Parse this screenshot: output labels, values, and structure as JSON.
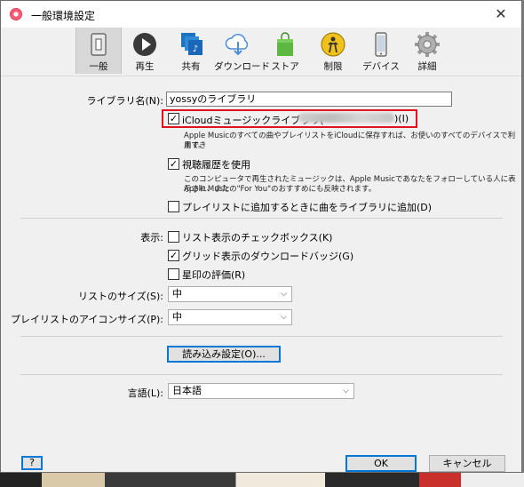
{
  "window": {
    "title": "一般環境設定",
    "close_glyph": "✕"
  },
  "toolbar": {
    "tabs": [
      {
        "label": "一般",
        "icon": "general-switch-icon"
      },
      {
        "label": "再生",
        "icon": "play-icon"
      },
      {
        "label": "共有",
        "icon": "sharing-icon"
      },
      {
        "label": "ダウンロード",
        "icon": "cloud-download-icon"
      },
      {
        "label": "ストア",
        "icon": "store-bag-icon"
      },
      {
        "label": "制限",
        "icon": "parental-restrictions-icon"
      },
      {
        "label": "デバイス",
        "icon": "device-phone-icon"
      },
      {
        "label": "詳細",
        "icon": "gear-icon"
      }
    ],
    "selected": "一般"
  },
  "library": {
    "name_label": "ライブラリ名(N):",
    "name_value": "yossyのライブラリ",
    "icloud_label_prefix": "iCloudミュージックライブラリ(",
    "icloud_label_suffix": ")(I)",
    "icloud_checked": true,
    "icloud_desc_line1": "Apple Musicのすべての曲やプレイリストをiCloudに保存すれば、お使いのすべてのデバイスで利用でき",
    "icloud_desc_line2": "ます。",
    "history_label": "視聴履歴を使用",
    "history_checked": true,
    "history_desc_line1": "このコンピュータで再生されたミュージックは、Apple Musicであなたをフォローしている人に表示され、また",
    "history_desc_line2": "Apple Musicの\"For You\"のおすすめにも反映されます。",
    "playlist_add_label": "プレイリストに追加するときに曲をライブラリに追加(D)",
    "playlist_add_checked": false
  },
  "display": {
    "label": "表示:",
    "list_checkbox_label": "リスト表示のチェックボックス(K)",
    "list_checkbox_checked": false,
    "grid_download_label": "グリッド表示のダウンロードバッジ(G)",
    "grid_download_checked": true,
    "star_rating_label": "星印の評価(R)",
    "star_rating_checked": false,
    "check_glyph": "✓"
  },
  "list_size": {
    "label": "リストのサイズ(S):",
    "value": "中"
  },
  "playlist_icon_size": {
    "label": "プレイリストのアイコンサイズ(P):",
    "value": "中"
  },
  "import_button": "読み込み設定(O)...",
  "language": {
    "label": "言語(L):",
    "value": "日本語"
  },
  "footer": {
    "help": "?",
    "ok": "OK",
    "cancel": "キャンセル"
  },
  "dropdown_arrow": "⌵"
}
